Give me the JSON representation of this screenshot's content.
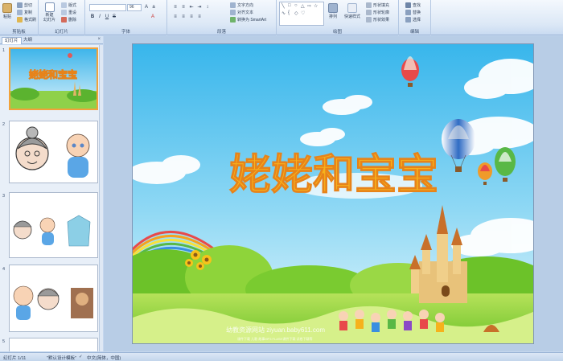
{
  "ribbon": {
    "clipboard": {
      "label": "剪贴板",
      "paste": "粘贴",
      "cut": "剪切",
      "copy": "复制",
      "format_painter": "格式刷"
    },
    "slides": {
      "label": "幻灯片",
      "new_slide": "新建\n幻灯片",
      "layout": "版式",
      "reset": "重设",
      "delete": "删除"
    },
    "font": {
      "label": "字体",
      "font_placeholder": "",
      "size_value": "96"
    },
    "paragraph": {
      "label": "段落",
      "text_direction": "文字方向",
      "align_text": "对齐文本",
      "smartart": "转换为 SmartArt"
    },
    "drawing": {
      "label": "绘图",
      "arrange": "排列",
      "quick_styles": "快速样式",
      "shape_fill": "形状填充",
      "shape_outline": "形状轮廓",
      "shape_effects": "形状效果"
    },
    "editing": {
      "label": "编辑",
      "find": "查找",
      "replace": "替换",
      "select": "选择"
    }
  },
  "pane": {
    "tab_slides": "幻灯片",
    "tab_outline": "大纲",
    "close": "×"
  },
  "thumbs": [
    {
      "num": "1",
      "title": "姥姥和宝宝"
    },
    {
      "num": "2"
    },
    {
      "num": "3"
    },
    {
      "num": "4"
    },
    {
      "num": "5"
    }
  ],
  "slide": {
    "title": "姥姥和宝宝",
    "watermark_main": "幼教资源网站  ziyuan.baby611.com",
    "watermark_sub": "课件下载  儿歌  故事MP3  FLASH课件下载  试卷下载等"
  },
  "status": {
    "slide_count": "幻灯片 1/11",
    "theme": "\"默认设计模板\"",
    "language": "中文(简体，中国)"
  },
  "colors": {
    "title_fill": "#f6b21c",
    "selected_border": "#f2a23a",
    "sky_top": "#54c2ec"
  }
}
